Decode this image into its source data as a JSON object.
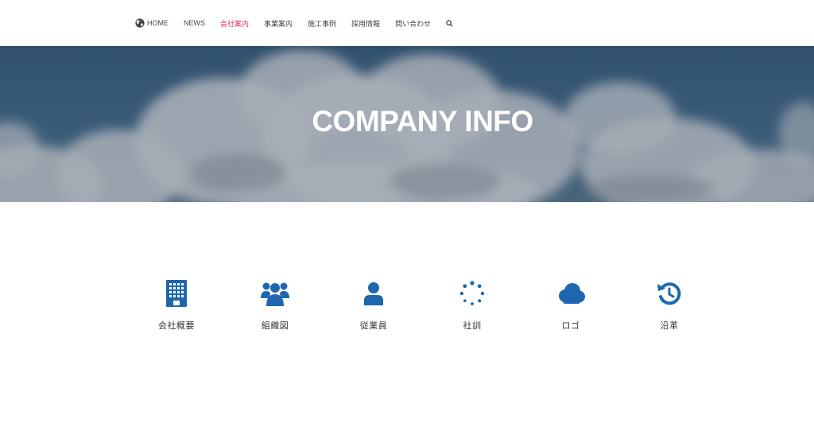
{
  "nav": {
    "items": [
      {
        "label": "HOME",
        "active": false
      },
      {
        "label": "NEWS",
        "active": false
      },
      {
        "label": "会社案内",
        "active": true
      },
      {
        "label": "事業案内",
        "active": false
      },
      {
        "label": "施工事例",
        "active": false
      },
      {
        "label": "採用情報",
        "active": false
      },
      {
        "label": "問い合わせ",
        "active": false
      }
    ],
    "home_icon": "globe-icon",
    "search_icon": "search-icon",
    "active_color": "#d6336c"
  },
  "hero": {
    "title": "COMPANY INFO"
  },
  "menu": {
    "items": [
      {
        "label": "会社概要",
        "icon": "building-icon"
      },
      {
        "label": "組織図",
        "icon": "users-icon"
      },
      {
        "label": "従業員",
        "icon": "user-icon"
      },
      {
        "label": "社訓",
        "icon": "spinner-icon"
      },
      {
        "label": "ロゴ",
        "icon": "cloud-icon"
      },
      {
        "label": "沿革",
        "icon": "history-icon"
      }
    ],
    "icon_color": "#1e67ae"
  }
}
